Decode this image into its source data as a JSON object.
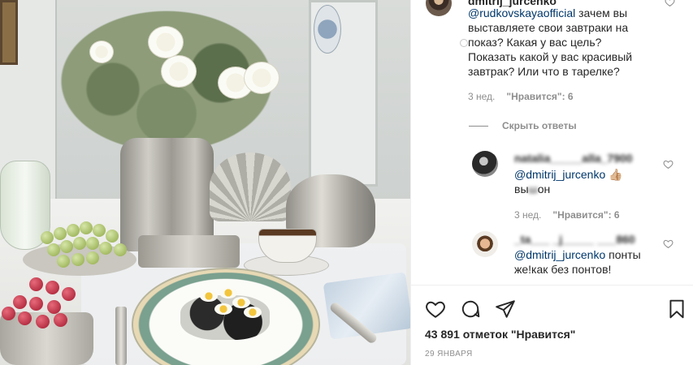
{
  "photo": {
    "description_icon": "breakfast-photo"
  },
  "comments": {
    "first": {
      "username": "dmitrij_jurcenko",
      "mention": "@rudkovskayaofficial",
      "text_line1": " зачем вы",
      "text_line2": "выставляете свои завтраки на",
      "text_line3": "показ? Какая у вас цель?",
      "text_line4": "Показать какой у вас красивый",
      "text_line5": "завтрак? Или что в тарелке?",
      "time": "3 нед.",
      "likes": "\"Нравится\": 6"
    },
    "hide_replies": "Скрыть ответы",
    "reply1": {
      "username": "natalia_____alla_7900",
      "mention": "@dmitrij_jurcenko",
      "emoji": "👍🏼",
      "text_pre": "вы",
      "text_blur": "ш",
      "text_post": "он",
      "time": "3 нед.",
      "likes": "\"Нравится\": 6"
    },
    "reply2": {
      "username": "_ta___ _j_____ ___860",
      "mention": "@dmitrij_jurcenko",
      "text_line1": " понты",
      "text_line2": "же!как без понтов!"
    }
  },
  "actions": {
    "like_icon": "heart-icon",
    "comment_icon": "comment-icon",
    "share_icon": "share-icon",
    "save_icon": "bookmark-icon"
  },
  "likes_count": "43 891 отметок \"Нравится\"",
  "date": "29 января"
}
